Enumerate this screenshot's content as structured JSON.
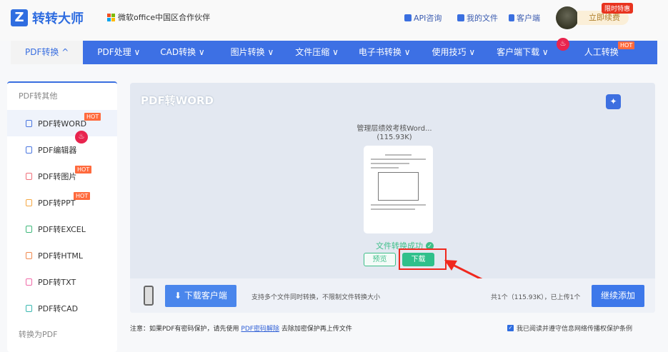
{
  "header": {
    "logo_text": "转转大师",
    "partner": "微软office中国区合作伙伴",
    "links": [
      "API咨询",
      "我的文件",
      "客户端"
    ],
    "vip_label": "立即续费",
    "vip_tag": "限时特惠"
  },
  "nav": {
    "items": [
      "PDF转换 ^",
      "PDF处理 ∨",
      "CAD转换 ∨",
      "图片转换 ∨",
      "文件压缩 ∨",
      "电子书转换 ∨",
      "使用技巧 ∨",
      "客户端下载 ∨",
      "人工转换"
    ],
    "hot": "HOT"
  },
  "sidebar": {
    "group1": "PDF转其他",
    "items": [
      {
        "label": "PDF转WORD",
        "badge": "HOT",
        "color": "#4a76e0"
      },
      {
        "label": "PDF编辑器",
        "badge": "fire",
        "color": "#4a76e0"
      },
      {
        "label": "PDF转图片",
        "badge": "HOT",
        "color": "#f0707a"
      },
      {
        "label": "PDF转PPT",
        "badge": "HOT",
        "color": "#f5a742"
      },
      {
        "label": "PDF转EXCEL",
        "badge": "",
        "color": "#3fb87a"
      },
      {
        "label": "PDF转HTML",
        "badge": "",
        "color": "#f08a50"
      },
      {
        "label": "PDF转TXT",
        "badge": "",
        "color": "#f06aa8"
      },
      {
        "label": "PDF转CAD",
        "badge": "",
        "color": "#3ab8b0"
      }
    ],
    "group2": "转换为PDF"
  },
  "main": {
    "title": "PDF转WORD",
    "file_name": "管理层绩效考核Word...",
    "file_size": "(115.93K)",
    "status": "文件转换成功",
    "preview": "预览",
    "download": "下载",
    "download_client": "下载客户端",
    "support_text": "支持多个文件同时转换，不限制文件转换大小",
    "count_text": "共1个（115.93K），已上传1个",
    "continue": "继续添加"
  },
  "footer": {
    "note_prefix": "注意：如果PDF有密码保护，请先使用",
    "note_link": "PDF密码解除",
    "note_suffix": "去除加密保护再上传文件",
    "agree": "我已阅读并遵守信息网络传播权保护条例",
    "agree_checked": true
  }
}
